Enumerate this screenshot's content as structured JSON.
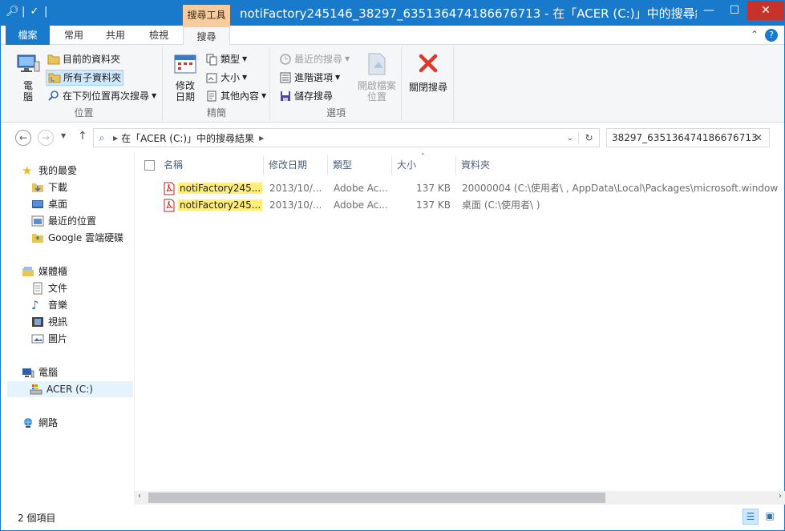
{
  "window": {
    "title": "notiFactory245146_38297_635136474186676713 - 在「ACER (C:)」中的搜尋結...",
    "context_tab": "搜尋工具"
  },
  "tabs": {
    "file": "檔案",
    "home": "常用",
    "share": "共用",
    "view": "檢視",
    "search": "搜尋"
  },
  "ribbon": {
    "location": {
      "label": "位置",
      "computer": "電\n腦",
      "current_folder": "目前的資料夾",
      "all_subfolders": "所有子資料夾",
      "search_again": "在下列位置再次搜尋"
    },
    "refine": {
      "label": "精簡",
      "date_modified": "修改\n日期",
      "kind": "類型",
      "size": "大小",
      "other_props": "其他內容"
    },
    "options": {
      "label": "選項",
      "recent_searches": "最近的搜尋",
      "advanced_options": "進階選項",
      "save_search": "儲存搜尋",
      "open_file_location": "開啟檔案\n位置"
    },
    "close": {
      "close_search": "關閉搜尋"
    }
  },
  "address": {
    "path": "在「ACER (C:)」中的搜尋結果",
    "search_value": "38297_635136474186676713"
  },
  "navpane": {
    "favorites": "我的最愛",
    "downloads": "下載",
    "desktop": "桌面",
    "recent": "最近的位置",
    "gdrive": "Google 雲端硬碟",
    "libraries": "媒體櫃",
    "documents": "文件",
    "music": "音樂",
    "videos": "視訊",
    "pictures": "圖片",
    "computer": "電腦",
    "drive_c": "ACER (C:)",
    "network": "網路"
  },
  "columns": {
    "name": "名稱",
    "date": "修改日期",
    "type": "類型",
    "size": "大小",
    "folder": "資料夾"
  },
  "files": [
    {
      "name": "notiFactory245...",
      "date": "2013/10/...",
      "type": "Adobe Ac...",
      "size": "137 KB",
      "folder": "20000004 (C:\\使用者\\ ,  AppData\\Local\\Packages\\microsoft.window"
    },
    {
      "name": "notiFactory245...",
      "date": "2013/10/...",
      "type": "Adobe Ac...",
      "size": "137 KB",
      "folder": "桌面 (C:\\使用者\\ )"
    }
  ],
  "status": {
    "item_count": "2 個項目"
  },
  "colors": {
    "titlebar": "#1979ca",
    "context": "#f6cb9e",
    "highlight": "#ffef7a",
    "close": "#c7332b"
  }
}
